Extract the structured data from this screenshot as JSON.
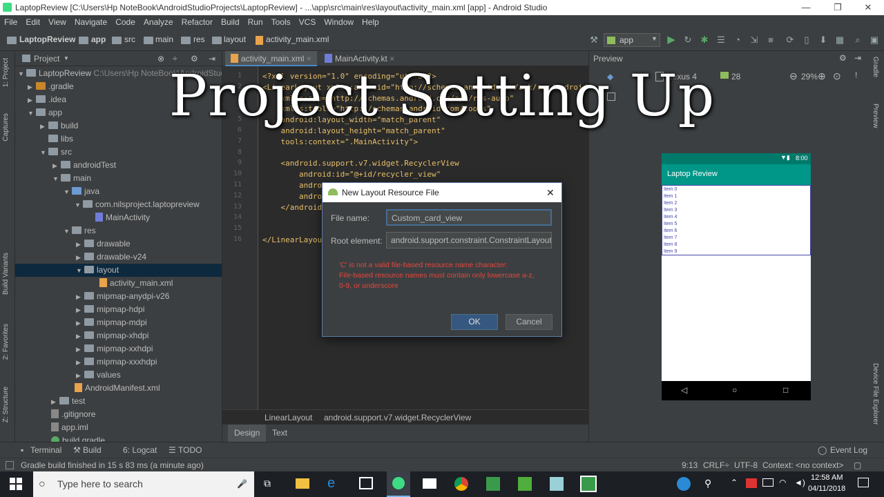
{
  "window": {
    "title": "LaptopReview [C:\\Users\\Hp NoteBook\\AndroidStudioProjects\\LaptopReview] - ...\\app\\src\\main\\res\\layout\\activity_main.xml [app] - Android Studio",
    "minimize": "—",
    "maximize": "❐",
    "close": "✕"
  },
  "menu": [
    "File",
    "Edit",
    "View",
    "Navigate",
    "Code",
    "Analyze",
    "Refactor",
    "Build",
    "Run",
    "Tools",
    "VCS",
    "Window",
    "Help"
  ],
  "breadcrumbs": [
    "LaptopReview",
    "app",
    "src",
    "main",
    "res",
    "layout",
    "activity_main.xml"
  ],
  "toolbar": {
    "run_config": "app"
  },
  "left_strip": {
    "project": "1: Project",
    "captures": "Captures",
    "build_variants": "Build Variants",
    "favorites": "2: Favorites",
    "structure": "Z: Structure"
  },
  "right_strip": {
    "gradle": "Gradle",
    "preview": "Preview",
    "device_explorer": "Device File Explorer"
  },
  "project_panel": {
    "header": "Project",
    "root": "LaptopReview",
    "root_path": "C:\\Users\\Hp NoteBook\\AndroidStudio",
    "items": [
      ".gradle",
      ".idea",
      "app",
      "build",
      "libs",
      "src",
      "androidTest",
      "main",
      "java",
      "com.nilsproject.laptopreview",
      "MainActivity",
      "res",
      "drawable",
      "drawable-v24",
      "layout",
      "activity_main.xml",
      "mipmap-anydpi-v26",
      "mipmap-hdpi",
      "mipmap-mdpi",
      "mipmap-xhdpi",
      "mipmap-xxhdpi",
      "mipmap-xxxhdpi",
      "values",
      "AndroidManifest.xml",
      "test",
      ".gitignore",
      "app.iml",
      "build.gradle"
    ]
  },
  "editor": {
    "tabs": [
      "activity_main.xml",
      "MainActivity.kt"
    ],
    "line_numbers": [
      "1",
      "2",
      "3",
      "4",
      "5",
      "6",
      "7",
      "8",
      "9",
      "10",
      "11",
      "12",
      "13",
      "14",
      "15",
      "16"
    ],
    "code_lines": [
      "<?xml version=\"1.0\" encoding=\"utf-8\"?>",
      "<LinearLayout xmlns:android=\"http://schemas.android.com/apk/res/android\"",
      "    xmlns:app=\"http://schemas.android.com/apk/res-auto\"",
      "    xmlns:tools=\"http://schemas.android.com/tools\"",
      "    android:layout_width=\"match_parent\"",
      "    android:layout_height=\"match_parent\"",
      "    tools:context=\".MainActivity\">",
      "",
      "    <android.support.v7.widget.RecyclerView",
      "        android:id=\"@+id/recycler_view\"",
      "        android:layout_width=\"match_parent\"",
      "        android:layout_height=\"match_parent\"",
      "    </android.support.v7.widget.RecyclerView>",
      "",
      "",
      "</LinearLayout>"
    ],
    "breadcrumb": [
      "LinearLayout",
      "android.support.v7.widget.RecyclerView"
    ],
    "design_tabs": [
      "Design",
      "Text"
    ]
  },
  "preview": {
    "header": "Preview",
    "device": "Nexus 4",
    "api": "28",
    "zoom": "29%",
    "phone_time": "8:00",
    "app_title": "Laptop Review",
    "app_bar_color": "#009688",
    "list_items": [
      "Item 0",
      "Item 1",
      "Item 2",
      "Item 3",
      "Item 4",
      "Item 5",
      "Item 6",
      "Item 7",
      "Item 8",
      "Item 9"
    ]
  },
  "dialog": {
    "title": "New Layout Resource File",
    "file_name_label": "File name:",
    "file_name_value": "Custom_card_view",
    "root_element_label": "Root element:",
    "root_element_value": "android.support.constraint.ConstraintLayout",
    "error_lines": [
      "'C' is not a valid file-based resource name character:",
      "File-based resource names must contain only lowercase a-z,",
      "0-9, or underscore"
    ],
    "ok": "OK",
    "cancel": "Cancel"
  },
  "bottom_tools": [
    "Terminal",
    "Build",
    "6: Logcat",
    "TODO"
  ],
  "event_log": "Event Log",
  "status": {
    "message": "Gradle build finished in 15 s 83 ms (a minute ago)",
    "position": "9:13",
    "line_sep": "CRLF÷",
    "encoding": "UTF-8",
    "context": "Context: <no context>"
  },
  "taskbar": {
    "search_placeholder": "Type here to search",
    "time": "12:58 AM",
    "date": "04/11/2018"
  },
  "overlay_title": "Project Setting Up",
  "colors": {
    "accent": "#4a88c7",
    "error": "#e8453c",
    "overlay": "#ffffff"
  }
}
